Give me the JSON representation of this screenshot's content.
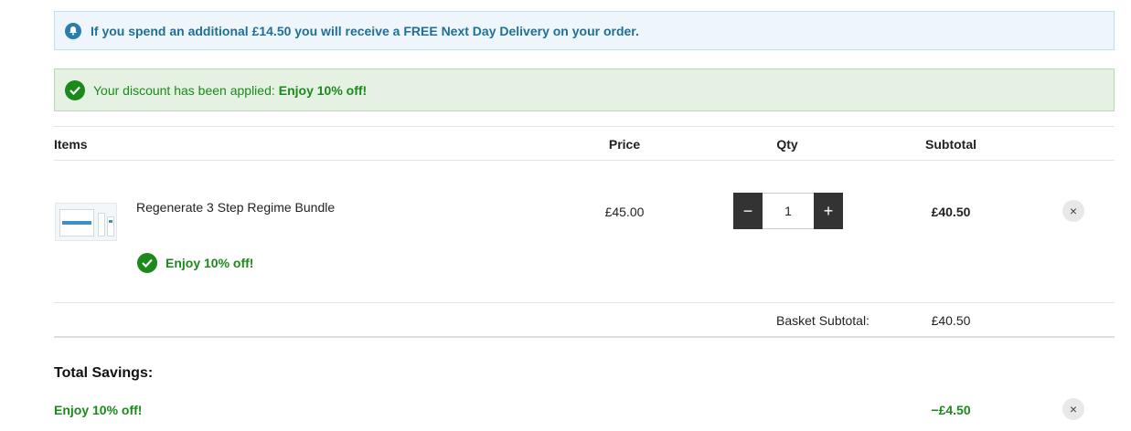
{
  "notices": {
    "delivery_message": "If you spend an additional £14.50 you will receive a FREE Next Day Delivery on your order.",
    "discount_prefix": "Your discount has been applied:",
    "discount_highlight": "Enjoy 10% off!"
  },
  "table": {
    "headers": {
      "items": "Items",
      "price": "Price",
      "qty": "Qty",
      "subtotal": "Subtotal"
    }
  },
  "basket": {
    "items": [
      {
        "name": "Regenerate 3 Step Regime Bundle",
        "promo": "Enjoy 10% off!",
        "price": "£45.00",
        "quantity": "1",
        "subtotal": "£40.50",
        "decrement_symbol": "−",
        "increment_symbol": "+",
        "remove_symbol": "×"
      }
    ],
    "subtotal_label": "Basket Subtotal:",
    "subtotal_value": "£40.50"
  },
  "savings": {
    "title": "Total Savings:",
    "rows": [
      {
        "label": "Enjoy 10% off!",
        "value": "−£4.50",
        "remove_symbol": "×"
      }
    ]
  },
  "icons": {
    "info": "bell-icon",
    "success": "check-circle-icon",
    "remove": "close-icon"
  },
  "colors": {
    "info_text": "#1f6f96",
    "info_bg": "#eef6fb",
    "success_text": "#1b8a1b",
    "success_bg": "#e5f1e3",
    "qty_button_bg": "#333333"
  }
}
